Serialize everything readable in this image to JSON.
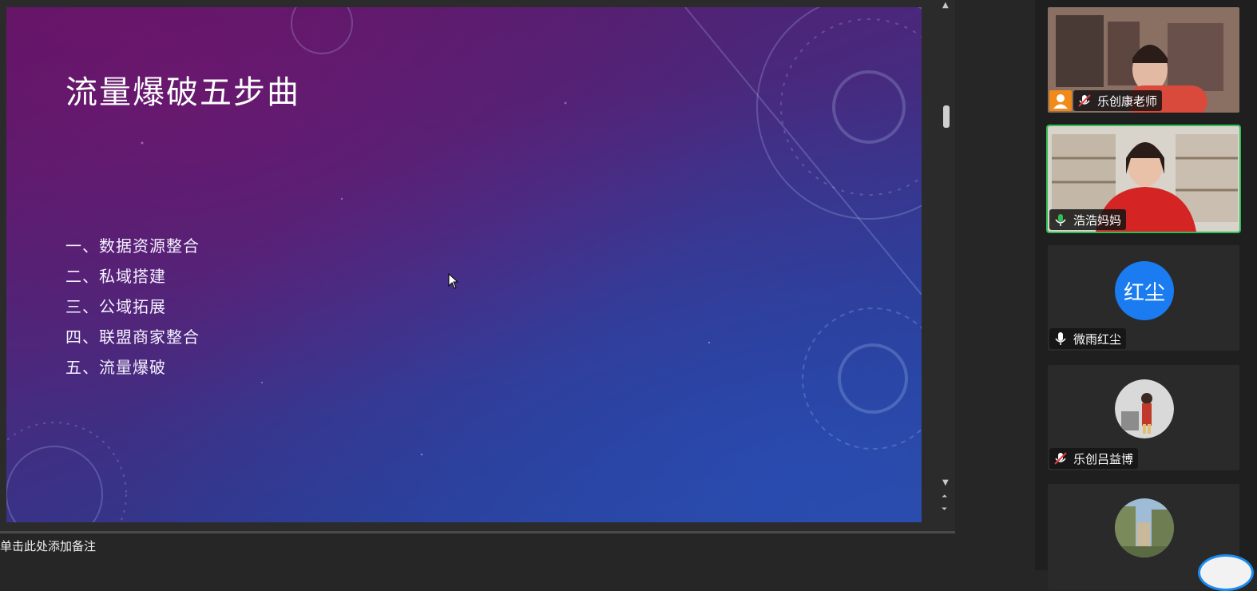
{
  "slide": {
    "title": "流量爆破五步曲",
    "items": [
      "一、数据资源整合",
      "二、私域搭建",
      "三、公域拓展",
      "四、联盟商家整合",
      "五、流量爆破"
    ]
  },
  "notes": {
    "placeholder": "单击此处添加备注"
  },
  "participants": [
    {
      "name": "乐创康老师",
      "mic": "muted",
      "video": "on"
    },
    {
      "name": "浩浩妈妈",
      "mic": "on",
      "video": "on",
      "speaking": true
    },
    {
      "name": "微雨红尘",
      "mic": "on",
      "video": "off",
      "avatar_text": "红尘"
    },
    {
      "name": "乐创吕益博",
      "mic": "muted",
      "video": "off"
    },
    {
      "name": "",
      "mic": "unknown",
      "video": "off"
    }
  ],
  "colors": {
    "speaking_border": "#2fbf54",
    "avatar_blue": "#1a7cf0",
    "muted_red": "#e23b3b",
    "mic_green": "#2fbf54"
  }
}
